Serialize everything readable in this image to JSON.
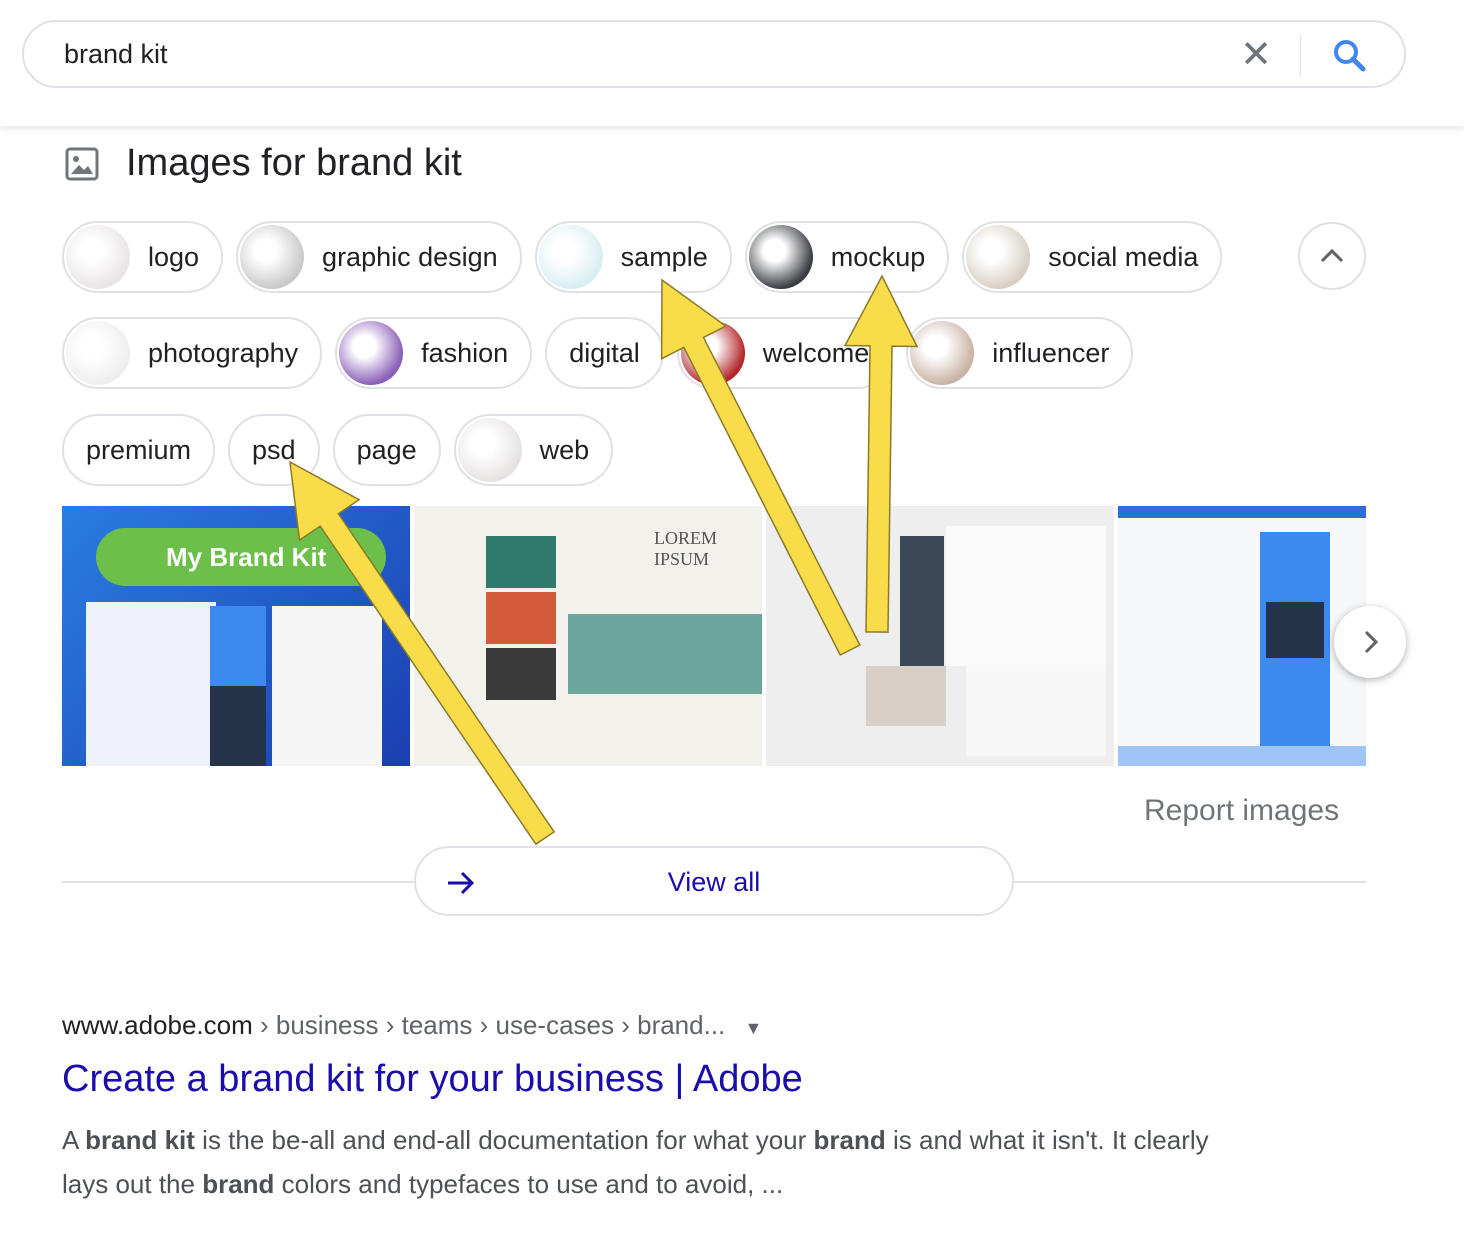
{
  "search": {
    "query": "brand kit",
    "clear_icon": "close-icon",
    "search_icon": "search-icon",
    "accent": "#4285f4"
  },
  "images_header": {
    "title": "Images for brand kit",
    "icon": "image-icon"
  },
  "chips": {
    "row1": [
      {
        "label": "logo",
        "thumb": "#e9e4e6"
      },
      {
        "label": "graphic design",
        "thumb": "#c9c9c9"
      },
      {
        "label": "sample",
        "thumb": "#d9eef2"
      },
      {
        "label": "mockup",
        "thumb": "#3a3d44"
      },
      {
        "label": "social media",
        "thumb": "#d8cfc4"
      }
    ],
    "row2": [
      {
        "label": "photography",
        "thumb": "#eeeeee"
      },
      {
        "label": "fashion",
        "thumb": "#8a5fb8"
      },
      {
        "label": "digital",
        "thumb": null
      },
      {
        "label": "welcome",
        "thumb": "#b3262b"
      },
      {
        "label": "influencer",
        "thumb": "#c9b3a6"
      }
    ],
    "row3": [
      {
        "label": "premium",
        "thumb": null
      },
      {
        "label": "psd",
        "thumb": null
      },
      {
        "label": "page",
        "thumb": null
      },
      {
        "label": "web",
        "thumb": "#e6e2e2"
      }
    ]
  },
  "collapse_icon": "chevron-up-icon",
  "images": [
    {
      "overlay_text": "My Brand Kit",
      "bg": "#1e5fd6"
    },
    {
      "overlay_text": "LOREM IPSUM",
      "bg": "#f3f1ec"
    },
    {
      "overlay_text": "",
      "bg": "#eeeeee"
    },
    {
      "overlay_text": "",
      "bg": "#f5f7fa"
    }
  ],
  "next_icon": "chevron-right-icon",
  "report_images": "Report images",
  "view_all": {
    "label": "View all",
    "icon": "arrow-right-icon",
    "color": "#1a0dab"
  },
  "result": {
    "breadcrumb": {
      "host": "www.adobe.com",
      "path": " › business › teams › use-cases › brand..."
    },
    "title": "Create a brand kit for your business | Adobe",
    "snippet": [
      {
        "t": "A ",
        "b": false
      },
      {
        "t": "brand kit",
        "b": true
      },
      {
        "t": " is the be-all and end-all documentation for what your ",
        "b": false
      },
      {
        "t": "brand",
        "b": true
      },
      {
        "t": " is and what it isn't. It clearly lays out the ",
        "b": false
      },
      {
        "t": "brand",
        "b": true
      },
      {
        "t": " colors and typefaces to use and to avoid, ...",
        "b": false
      }
    ]
  },
  "annotation": {
    "arrow_color": "#f9dc4a"
  }
}
